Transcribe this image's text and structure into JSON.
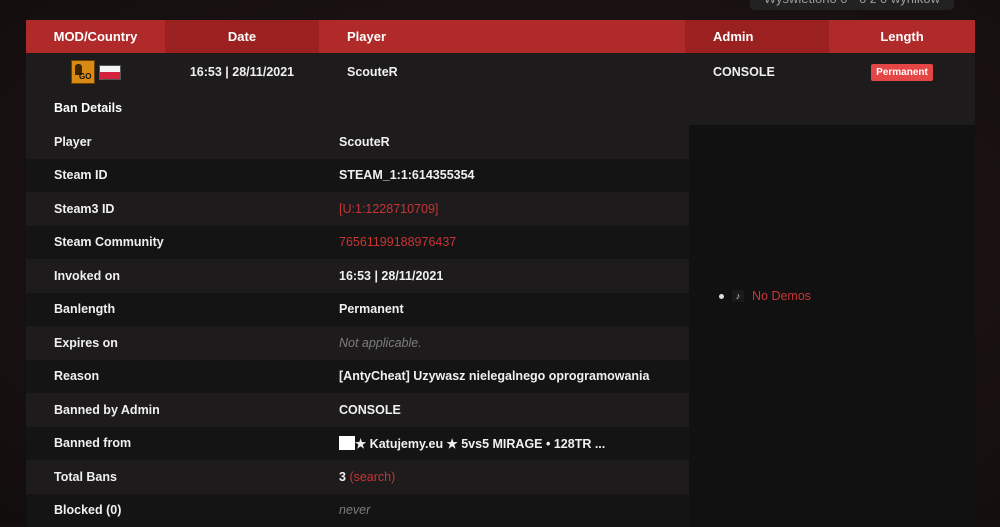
{
  "shown_note": "Wyświetlono 0 - 0 z 0 wyników",
  "table_headers": {
    "mod": "MOD/Country",
    "date": "Date",
    "player": "Player",
    "admin": "Admin",
    "length": "Length"
  },
  "ban_row": {
    "game_icon": "csgo-icon",
    "game_icon_text": "GO",
    "country_flag": "poland-flag-icon",
    "date": "16:53 | 28/11/2021",
    "player": "ScouteR",
    "admin": "CONSOLE",
    "length_badge": "Permanent"
  },
  "details": {
    "title": "Ban Details",
    "player": {
      "label": "Player",
      "value": "ScouteR"
    },
    "steam_id": {
      "label": "Steam ID",
      "value": "STEAM_1:1:614355354"
    },
    "steam3_id": {
      "label": "Steam3 ID",
      "value": "[U:1:1228710709]"
    },
    "steam_community": {
      "label": "Steam Community",
      "value": "76561199188976437"
    },
    "invoked_on": {
      "label": "Invoked on",
      "value": "16:53 | 28/11/2021"
    },
    "banlength": {
      "label": "Banlength",
      "value": "Permanent"
    },
    "expires_on": {
      "label": "Expires on",
      "value": "Not applicable."
    },
    "reason": {
      "label": "Reason",
      "value": "[AntyCheat] Uzywasz nielegalnego oprogramowania"
    },
    "banned_by": {
      "label": "Banned by Admin",
      "value": "CONSOLE"
    },
    "banned_from": {
      "label": "Banned from",
      "value": "★ Katujemy.eu ★ 5vs5 MIRAGE • 128TR ..."
    },
    "total_bans": {
      "label": "Total Bans",
      "value": "3",
      "link": "(search)"
    },
    "blocked": {
      "label": "Blocked (0)",
      "value": "never"
    }
  },
  "demos": {
    "icon": "demo-icon",
    "text": "No Demos"
  },
  "colors": {
    "accent": "#b02a2a",
    "link": "#c73535",
    "badge": "#e44545"
  }
}
